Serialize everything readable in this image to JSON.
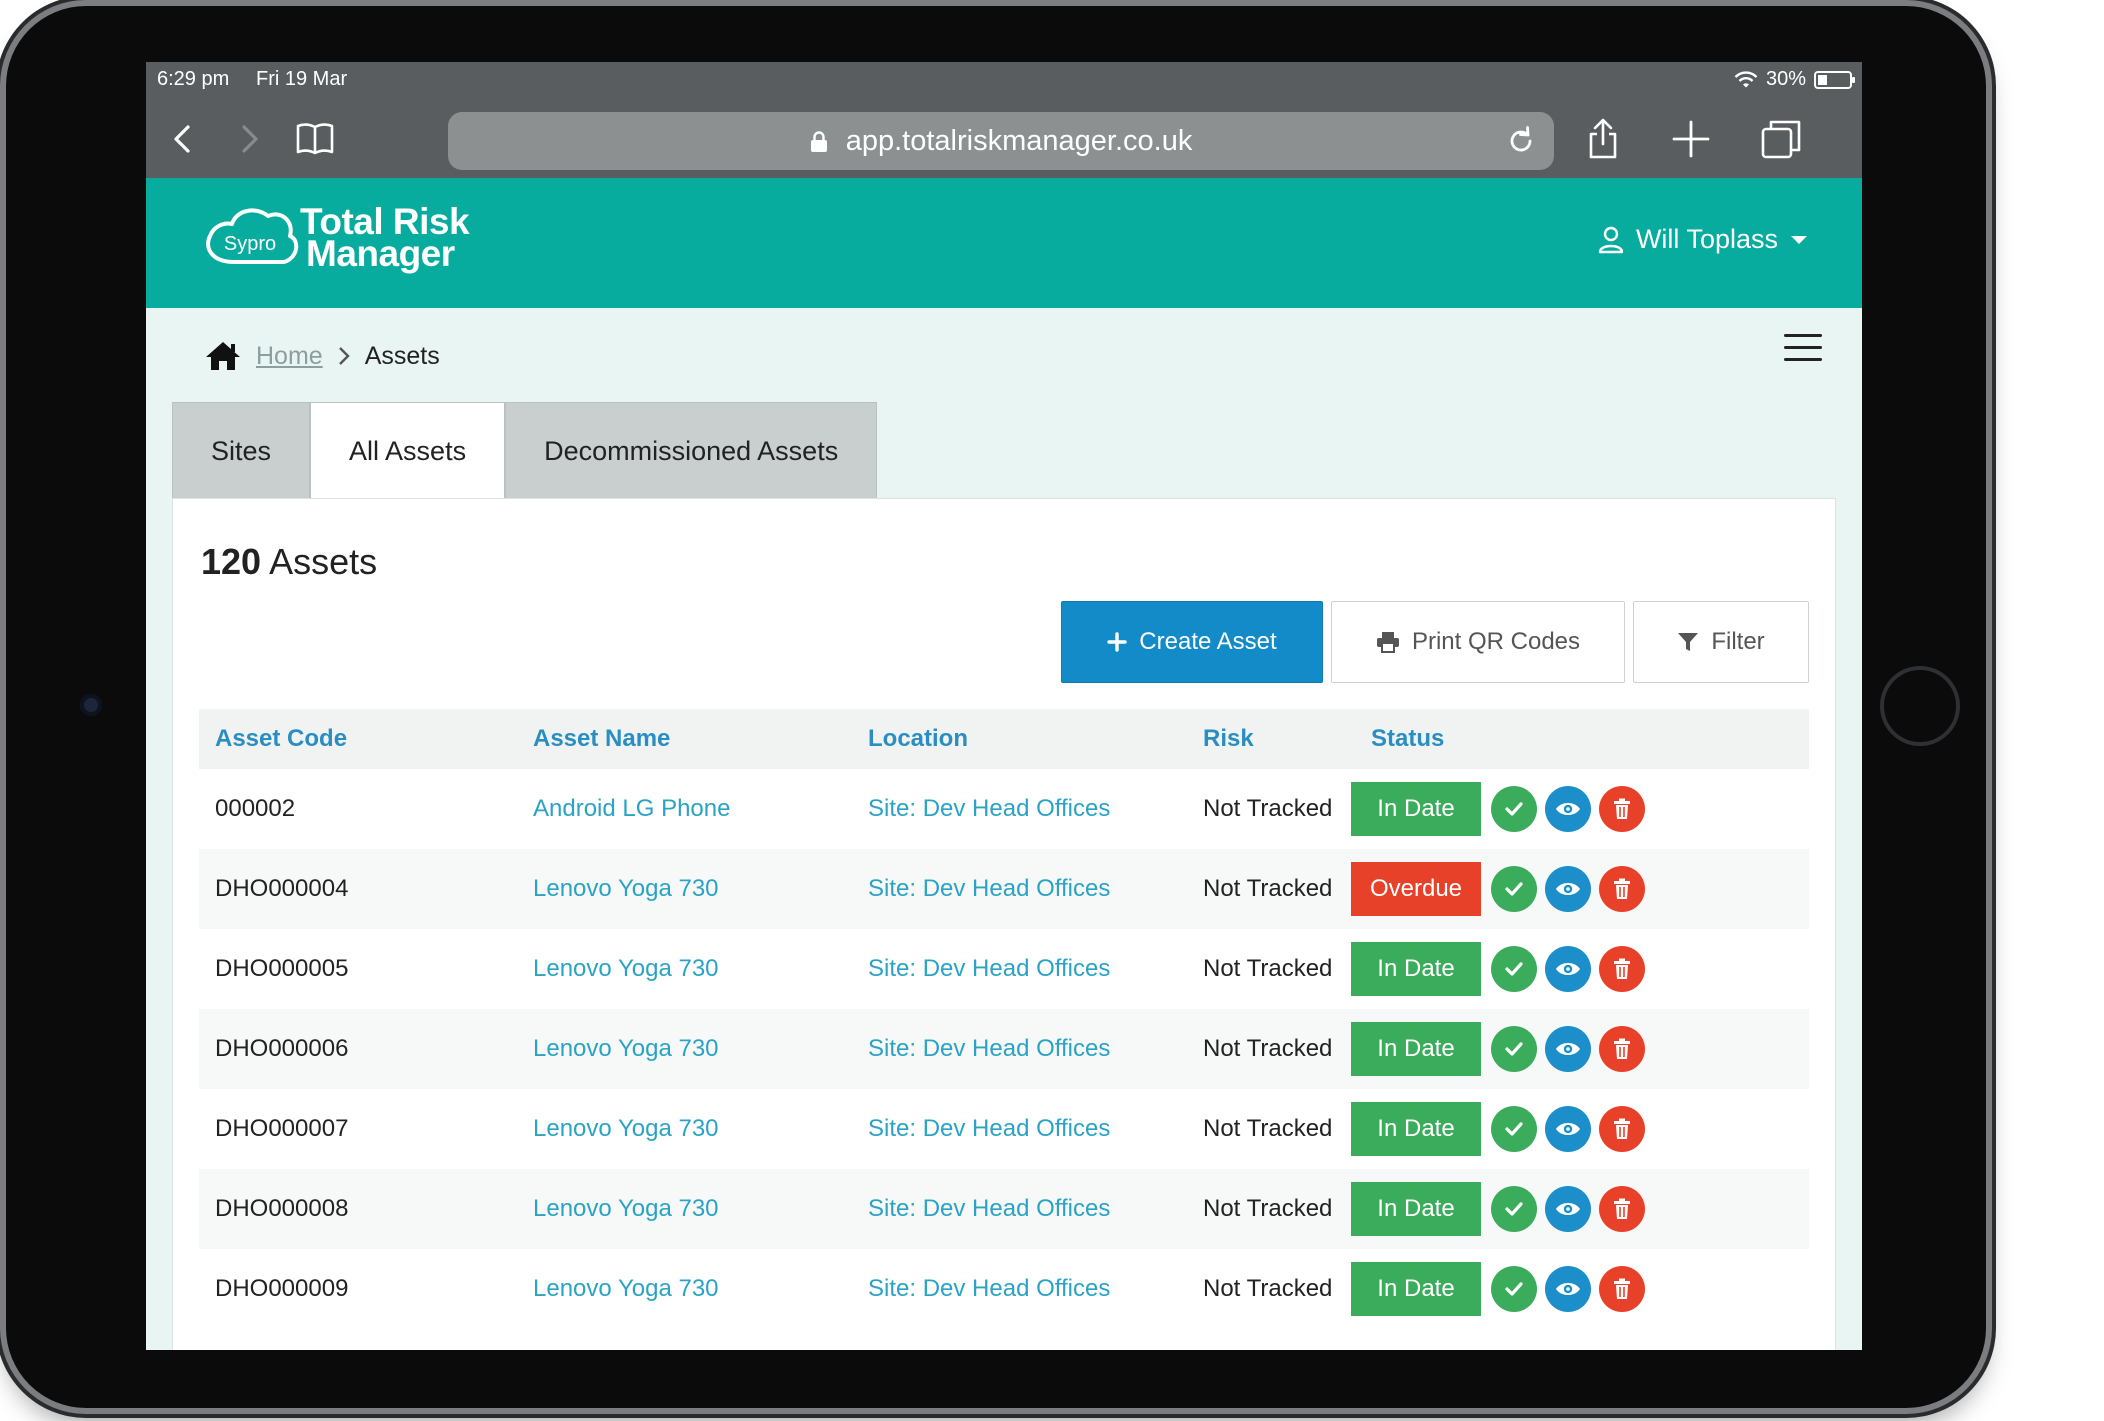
{
  "status_bar": {
    "time": "6:29 pm",
    "date": "Fri 19 Mar",
    "battery": "30%",
    "battery_level": 0.3
  },
  "browser": {
    "url": "app.totalriskmanager.co.uk"
  },
  "brand": {
    "mark": "Sypro",
    "line1": "Total Risk",
    "line2": "Manager"
  },
  "user": {
    "name": "Will Toplass"
  },
  "breadcrumb": {
    "home": "Home",
    "current": "Assets"
  },
  "tabs": [
    {
      "label": "Sites",
      "active": false
    },
    {
      "label": "All Assets",
      "active": true
    },
    {
      "label": "Decommissioned Assets",
      "active": false
    }
  ],
  "summary": {
    "count": "120",
    "label": "Assets"
  },
  "toolbar": {
    "create": "Create Asset",
    "print": "Print QR Codes",
    "filter": "Filter"
  },
  "table": {
    "headers": [
      "Asset Code",
      "Asset Name",
      "Location",
      "Risk",
      "Status"
    ],
    "rows": [
      {
        "code": "000002",
        "name": "Android LG Phone",
        "location": "Site: Dev Head Offices",
        "risk": "Not Tracked",
        "status": "In Date"
      },
      {
        "code": "DHO000004",
        "name": "Lenovo Yoga 730",
        "location": "Site: Dev Head Offices",
        "risk": "Not Tracked",
        "status": "Overdue"
      },
      {
        "code": "DHO000005",
        "name": "Lenovo Yoga 730",
        "location": "Site: Dev Head Offices",
        "risk": "Not Tracked",
        "status": "In Date"
      },
      {
        "code": "DHO000006",
        "name": "Lenovo Yoga 730",
        "location": "Site: Dev Head Offices",
        "risk": "Not Tracked",
        "status": "In Date"
      },
      {
        "code": "DHO000007",
        "name": "Lenovo Yoga 730",
        "location": "Site: Dev Head Offices",
        "risk": "Not Tracked",
        "status": "In Date"
      },
      {
        "code": "DHO000008",
        "name": "Lenovo Yoga 730",
        "location": "Site: Dev Head Offices",
        "risk": "Not Tracked",
        "status": "In Date"
      },
      {
        "code": "DHO000009",
        "name": "Lenovo Yoga 730",
        "location": "Site: Dev Head Offices",
        "risk": "Not Tracked",
        "status": "In Date"
      }
    ]
  },
  "colors": {
    "brand_teal": "#07ac9f",
    "primary_blue": "#138bc8",
    "in_date": "#3aac5c",
    "overdue": "#e8412a"
  }
}
